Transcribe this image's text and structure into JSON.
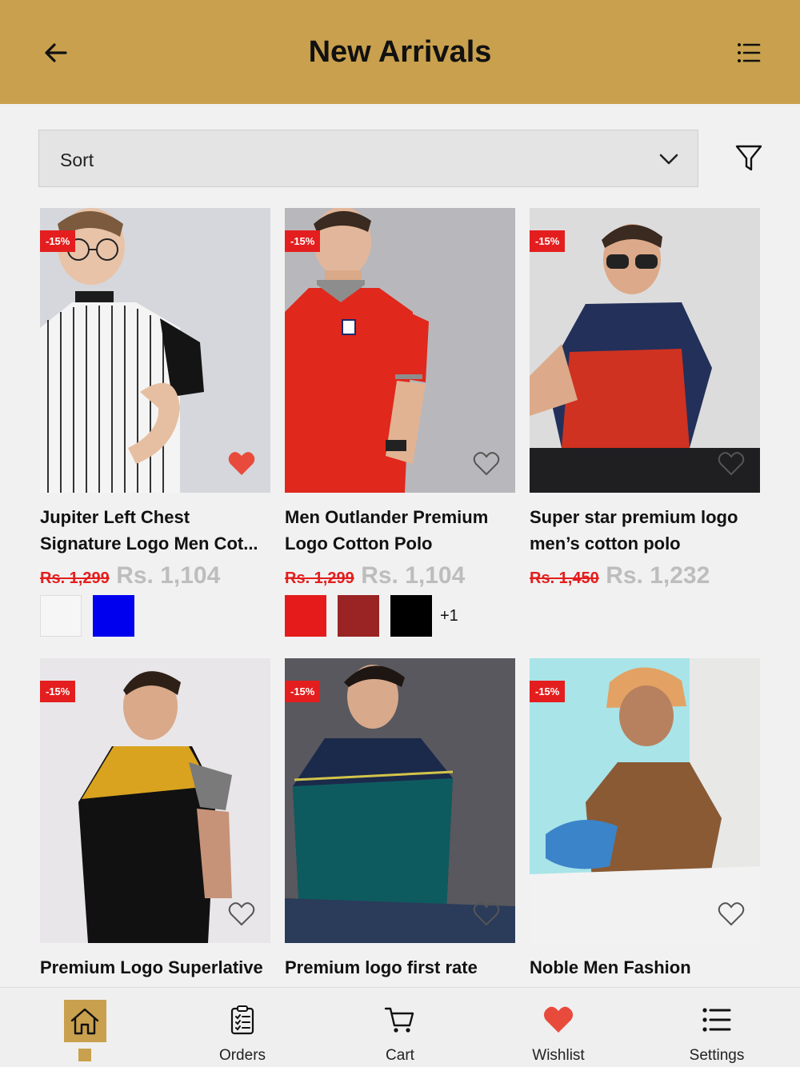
{
  "header": {
    "title": "New Arrivals"
  },
  "sort": {
    "label": "Sort"
  },
  "colors": {
    "accent": "#c9a04d",
    "sale": "#e41e1e",
    "heart": "#e84b3c"
  },
  "products": [
    {
      "badge": "-15%",
      "name_line1": "Jupiter Left Chest",
      "name_line2": "Signature Logo Men Cot...",
      "old_price": "Rs. 1,299",
      "new_price": "Rs. 1,104",
      "wishlisted": true
    },
    {
      "badge": "-15%",
      "name_line1": "Men Outlander Premium",
      "name_line2": "Logo Cotton Polo",
      "old_price": "Rs. 1,299",
      "new_price": "Rs. 1,104",
      "wishlisted": false,
      "more_colors": "+1"
    },
    {
      "badge": "-15%",
      "name_line1": "Super star premium logo",
      "name_line2": "men’s cotton polo",
      "old_price": "Rs. 1,450",
      "new_price": "Rs. 1,232",
      "wishlisted": false
    },
    {
      "badge": "-15%",
      "name_line1": "Premium Logo Superlative",
      "wishlisted": false
    },
    {
      "badge": "-15%",
      "name_line1": "Premium logo first rate",
      "wishlisted": false
    },
    {
      "badge": "-15%",
      "name_line1": "Noble Men Fashion",
      "wishlisted": false
    }
  ],
  "tabs": [
    {
      "label": "",
      "icon": "home-icon",
      "active": true
    },
    {
      "label": "Orders",
      "icon": "clipboard-icon"
    },
    {
      "label": "Cart",
      "icon": "cart-icon"
    },
    {
      "label": "Wishlist",
      "icon": "heart-icon"
    },
    {
      "label": "Settings",
      "icon": "list-icon"
    }
  ]
}
